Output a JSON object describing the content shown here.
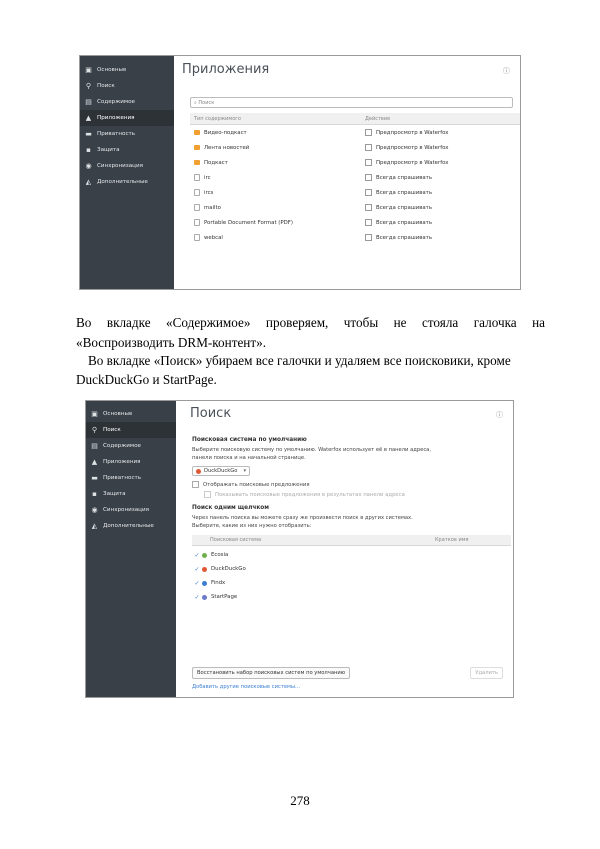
{
  "screenshot1": {
    "sidebar": [
      {
        "label": "Основные",
        "icon": "home-icon"
      },
      {
        "label": "Поиск",
        "icon": "search-icon"
      },
      {
        "label": "Содержимое",
        "icon": "document-icon"
      },
      {
        "label": "Приложения",
        "icon": "rocket-icon",
        "active": true
      },
      {
        "label": "Приватность",
        "icon": "mask-icon"
      },
      {
        "label": "Защита",
        "icon": "lock-icon"
      },
      {
        "label": "Синхронизация",
        "icon": "sync-icon"
      },
      {
        "label": "Дополнительные",
        "icon": "wizard-icon"
      }
    ],
    "title": "Приложения",
    "search_placeholder": "Поиск",
    "col_type": "Тип содержимого",
    "col_action": "Действие",
    "rows": [
      {
        "type": "Видео-подкаст",
        "action": "Предпросмотр в Waterfox",
        "icon": "feed"
      },
      {
        "type": "Лента новостей",
        "action": "Предпросмотр в Waterfox",
        "icon": "feed"
      },
      {
        "type": "Подкаст",
        "action": "Предпросмотр в Waterfox",
        "icon": "feed"
      },
      {
        "type": "irc",
        "action": "Всегда спрашивать",
        "icon": "doc"
      },
      {
        "type": "ircs",
        "action": "Всегда спрашивать",
        "icon": "doc"
      },
      {
        "type": "mailto",
        "action": "Всегда спрашивать",
        "icon": "doc"
      },
      {
        "type": "Portable Document Format (PDF)",
        "action": "Всегда спрашивать",
        "icon": "doc"
      },
      {
        "type": "webcal",
        "action": "Всегда спрашивать",
        "icon": "doc"
      }
    ]
  },
  "para1": "Во вкладке «Содержимое» проверяем, чтобы не стояла галочка на",
  "para1b": "«Воспроизводить DRM-контент».",
  "para2": "Во вкладке «Поиск» убираем все галочки и удаляем все поисковики, кроме",
  "para2b": "DuckDuckGo и StartPage.",
  "screenshot2": {
    "sidebar": [
      {
        "label": "Основные",
        "icon": "home-icon"
      },
      {
        "label": "Поиск",
        "icon": "search-icon",
        "active": true
      },
      {
        "label": "Содержимое",
        "icon": "document-icon"
      },
      {
        "label": "Приложения",
        "icon": "rocket-icon"
      },
      {
        "label": "Приватность",
        "icon": "mask-icon"
      },
      {
        "label": "Защита",
        "icon": "lock-icon"
      },
      {
        "label": "Синхронизация",
        "icon": "sync-icon"
      },
      {
        "label": "Дополнительные",
        "icon": "wizard-icon"
      }
    ],
    "title": "Поиск",
    "default_heading": "Поисковая система по умолчанию",
    "default_desc1": "Выберите поисковую систему по умолчанию. Waterfox использует её в панели адреса,",
    "default_desc2": "панели поиска и на начальной странице.",
    "default_engine": "DuckDuckGo",
    "suggest_label": "Отображать поисковые предложения",
    "suggest_sub": "Показывать поисковые предложения в результатах панели адреса",
    "oneclick_heading": "Поиск одним щелчком",
    "oneclick_desc1": "Через панель поиска вы можете сразу же произвести поиск в других системах.",
    "oneclick_desc2": "Выберите, какие из них нужно отобразить:",
    "col_engine": "Поисковая система",
    "col_keyword": "Краткое имя",
    "engines": [
      {
        "name": "Ecosia",
        "color": "#6fb04a"
      },
      {
        "name": "DuckDuckGo",
        "color": "#de5833"
      },
      {
        "name": "Findx",
        "color": "#3a7fd0"
      },
      {
        "name": "StartPage",
        "color": "#6c7ac9"
      }
    ],
    "restore_button": "Восстановить набор поисковых систем по умолчанию",
    "remove_button": "Удалить",
    "add_link": "Добавить другие поисковые системы..."
  },
  "page_number": "278"
}
